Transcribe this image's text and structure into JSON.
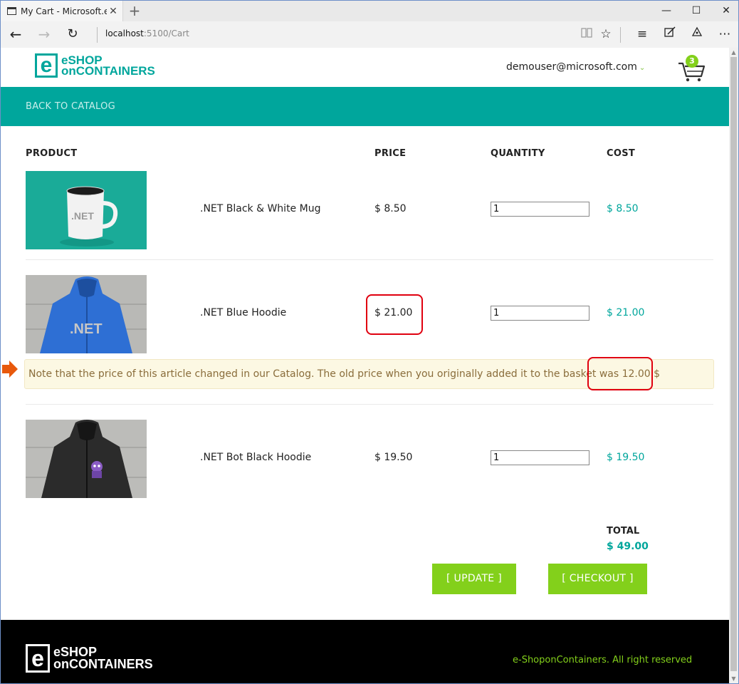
{
  "browser": {
    "tab_title": "My Cart - Microsoft.eSh",
    "tab_close": "✕",
    "new_tab": "+",
    "url_host": "localhost",
    "url_path": ":5100/Cart",
    "controls": {
      "minimize": "—",
      "maximize": "☐",
      "close": "✕"
    }
  },
  "header": {
    "logo_line1": "eSHOP",
    "logo_line2": "onCONTAINERS",
    "user_email": "demouser@microsoft.com",
    "cart_count": "3"
  },
  "nav": {
    "back_label": "BACK TO CATALOG"
  },
  "table": {
    "headers": {
      "product": "PRODUCT",
      "price": "PRICE",
      "quantity": "QUANTITY",
      "cost": "COST"
    },
    "items": [
      {
        "name": ".NET Black & White Mug",
        "price": "$ 8.50",
        "quantity": "1",
        "cost": "$ 8.50"
      },
      {
        "name": ".NET Blue Hoodie",
        "price": "$ 21.00",
        "quantity": "1",
        "cost": "$ 21.00"
      },
      {
        "name": ".NET Bot Black Hoodie",
        "price": "$ 19.50",
        "quantity": "1",
        "cost": "$ 19.50"
      }
    ]
  },
  "alert": {
    "message": "Note that the price of this article changed in our Catalog. The old price when you originally added it to the basket was 12.00 $"
  },
  "totals": {
    "label": "TOTAL",
    "value": "$ 49.00"
  },
  "actions": {
    "update": "[ UPDATE ]",
    "checkout": "[ CHECKOUT ]"
  },
  "footer": {
    "logo_line1": "eSHOP",
    "logo_line2": "onCONTAINERS",
    "rights": "e-ShoponContainers. All right reserved"
  },
  "colors": {
    "brand_teal": "#00a69c",
    "accent_green": "#83d01b",
    "highlight_red": "#e0000f",
    "annotation_arrow": "#e8590c"
  }
}
